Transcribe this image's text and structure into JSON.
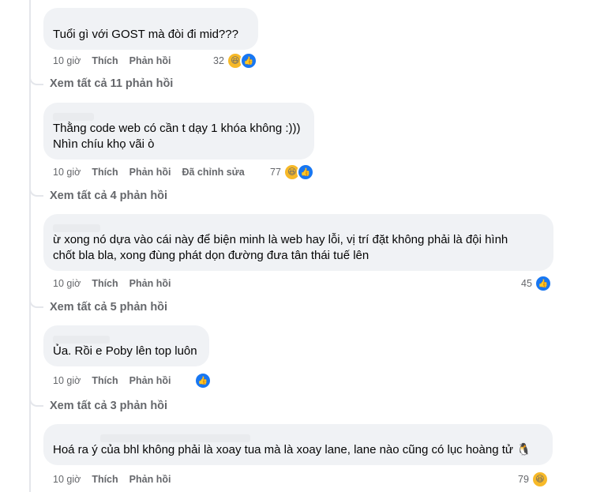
{
  "labels": {
    "like": "Thích",
    "reply": "Phản hồi",
    "edited": "Đã chỉnh sửa"
  },
  "comments": [
    {
      "text_lines": [
        "Tuổi   gì với GOST mà đòi đi mid???"
      ],
      "time": "10 giờ",
      "reaction_count": "32",
      "reactions": [
        "haha-icon",
        "like-icon"
      ],
      "replies_link": "Xem tất cả 11 phản hồi"
    },
    {
      "text_lines": [
        "Thằng code web có cần t dạy 1 khóa không :)))",
        "Nhìn chíu khọ vãi ò"
      ],
      "time": "10 giờ",
      "edited": true,
      "reaction_count": "77",
      "reactions": [
        "haha-icon",
        "like-icon"
      ],
      "replies_link": "Xem tất cả 4 phản hồi"
    },
    {
      "text_lines": [
        "ừ xong nó dựa vào cái này để biện minh là web hay lỗi, vị trí đặt không phải là đội hình",
        "chốt bla bla, xong đùng phát dọn đường đưa tân thái tuế lên"
      ],
      "time": "10 giờ",
      "reaction_count": "45",
      "reactions": [
        "like-icon"
      ],
      "replies_link": "Xem tất cả 5 phản hồi"
    },
    {
      "text_lines": [
        "Ủa. Rồi e Poby lên top luôn"
      ],
      "time": "10 giờ",
      "reaction_count": "",
      "reactions": [
        "like-icon"
      ],
      "replies_link": "Xem tất cả 3 phản hồi"
    },
    {
      "text_lines": [
        "Hoá ra ý của bhl không phải là xoay tua mà là xoay lane, lane nào cũng có lục hoàng tử 🐧"
      ],
      "time": "10 giờ",
      "reaction_count": "79",
      "reactions": [
        "haha-icon"
      ]
    }
  ]
}
